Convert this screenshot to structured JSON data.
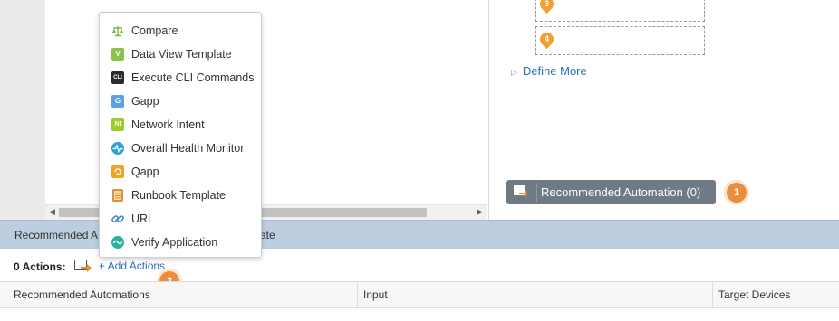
{
  "menu": {
    "items": [
      {
        "label": "Compare",
        "icon": "scale-icon",
        "color": "#7cb342"
      },
      {
        "label": "Data View Template",
        "icon": "data-view-icon",
        "color": "#8bc34a"
      },
      {
        "label": "Execute CLI Commands",
        "icon": "cli-icon",
        "color": "#2b2b2b"
      },
      {
        "label": "Gapp",
        "icon": "gapp-icon",
        "color": "#5aa3e0"
      },
      {
        "label": "Network Intent",
        "icon": "network-intent-icon",
        "color": "#9ccc2a"
      },
      {
        "label": "Overall Health Monitor",
        "icon": "health-monitor-icon",
        "color": "#29a3d8"
      },
      {
        "label": "Qapp",
        "icon": "qapp-icon",
        "color": "#f4a320"
      },
      {
        "label": "Runbook Template",
        "icon": "runbook-icon",
        "color": "#e0903a"
      },
      {
        "label": "URL",
        "icon": "link-icon",
        "color": "#3a7fd5"
      },
      {
        "label": "Verify Application",
        "icon": "verify-app-icon",
        "color": "#2bb3a0"
      }
    ],
    "icon_text": {
      "cli": "CLI",
      "gapp": "G",
      "ni": "NI",
      "data_view": "V"
    }
  },
  "right_panel": {
    "pin_3": "3",
    "pin_4": "4",
    "define_more": "Define More",
    "rec_button_label": "Recommended Automation (0)",
    "badge_1": "1"
  },
  "section_header": {
    "left_text": "Recommended A",
    "right_text": "ate"
  },
  "actions": {
    "count_label": "0 Actions:",
    "add_label": "+ Add Actions",
    "badge_2": "2"
  },
  "table": {
    "columns": [
      "Recommended Automations",
      "Input",
      "Target Devices"
    ]
  },
  "colors": {
    "accent_orange": "#ec8c3e",
    "link_blue": "#2a70b8",
    "header_bar": "#bccedf",
    "button_gray": "#6f7a84"
  }
}
